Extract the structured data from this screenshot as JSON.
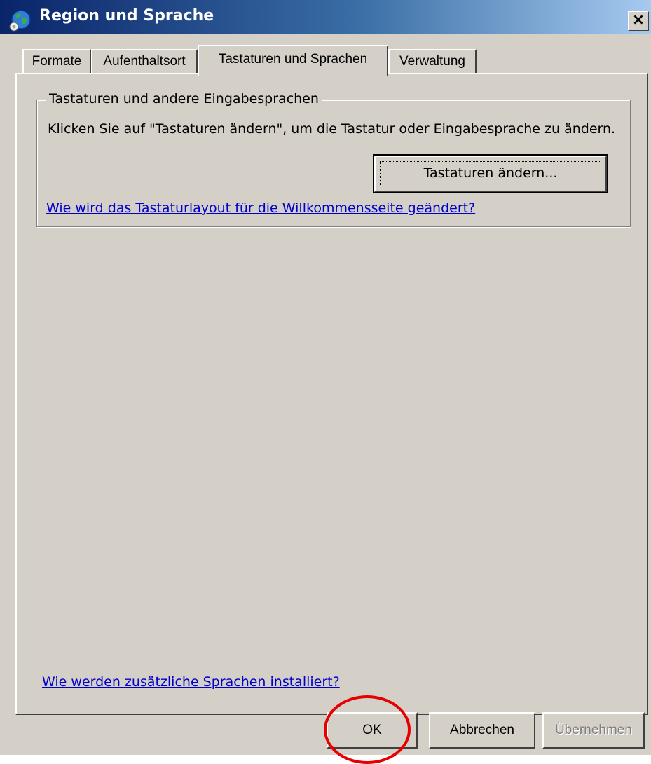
{
  "window": {
    "title": "Region und Sprache",
    "close_label": "×"
  },
  "tabs": [
    {
      "label": "Formate",
      "selected": false
    },
    {
      "label": "Aufenthaltsort",
      "selected": false
    },
    {
      "label": "Tastaturen und Sprachen",
      "selected": true
    },
    {
      "label": "Verwaltung",
      "selected": false
    }
  ],
  "keyboards_group": {
    "title": "Tastaturen und andere Eingabesprachen",
    "description": "Klicken Sie auf \"Tastaturen ändern\", um die Tastatur oder Eingabesprache zu ändern.",
    "change_button": "Tastaturen ändern...",
    "welcome_layout_link": "Wie wird das Tastaturlayout für die Willkommensseite geändert?"
  },
  "install_languages_link": "Wie werden zusätzliche Sprachen installiert?",
  "buttons": {
    "ok": "OK",
    "cancel": "Abbrechen",
    "apply": "Übernehmen",
    "apply_enabled": false
  },
  "annotation": {
    "color": "#e60000",
    "target": "ok-button"
  },
  "colors": {
    "dialog_bg": "#d4d0c8",
    "title_gradient_start": "#0a246a",
    "link": "#0000cc"
  }
}
